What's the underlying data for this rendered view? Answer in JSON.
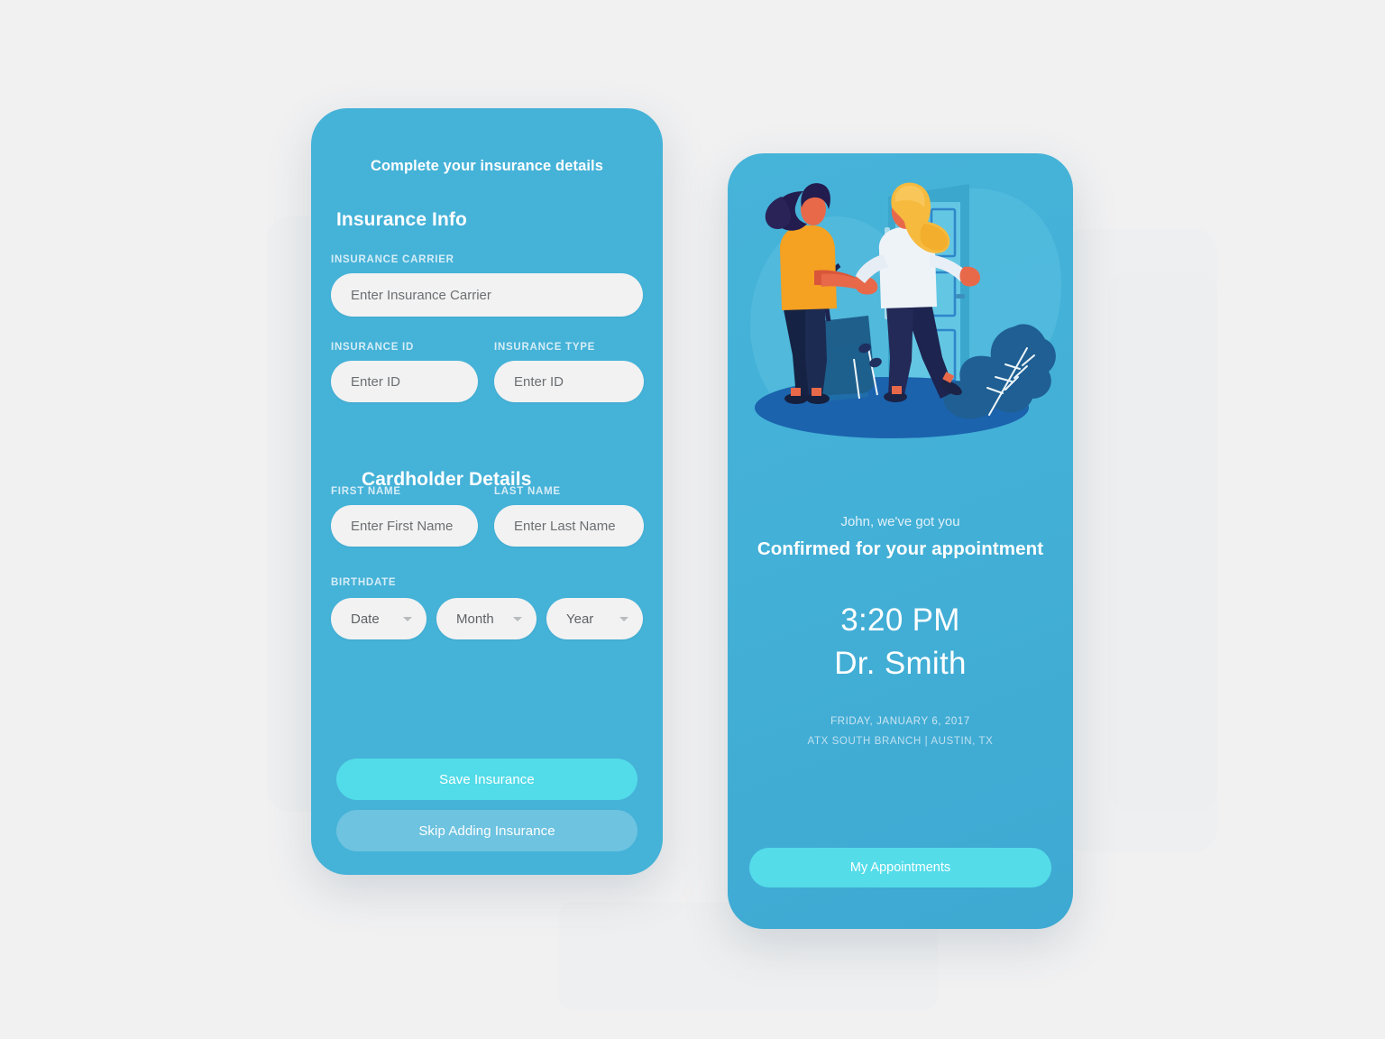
{
  "page": {
    "background_color": "#f1f1f2"
  },
  "insurance_screen": {
    "title": "Complete your insurance details",
    "sections": [
      {
        "heading": "Insurance Info"
      },
      {
        "heading": "Cardholder Details"
      }
    ],
    "fields": {
      "carrier": {
        "label": "INSURANCE CARRIER",
        "placeholder": "Enter Insurance Carrier",
        "value": ""
      },
      "insurance_id": {
        "label": "INSURANCE ID",
        "placeholder": "Enter ID",
        "value": ""
      },
      "insurance_type": {
        "label": "INSURANCE TYPE",
        "placeholder": "Enter ID",
        "value": ""
      },
      "first_name": {
        "label": "FIRST NAME",
        "placeholder": "Enter First Name",
        "value": ""
      },
      "last_name": {
        "label": "LAST NAME",
        "placeholder": "Enter Last Name",
        "value": ""
      },
      "birthdate": {
        "label": "BIRTHDATE",
        "day": {
          "selected": "Date"
        },
        "month": {
          "selected": "Month"
        },
        "year": {
          "selected": "Year"
        }
      }
    },
    "buttons": {
      "primary": "Save Insurance",
      "secondary": "Skip Adding Insurance"
    },
    "colors": {
      "card": "#45b2d8",
      "primary_button": "#52dbe8",
      "field": "#f2f2f2"
    }
  },
  "confirmation_screen": {
    "greeting": "John, we've got you",
    "headline": "Confirmed for your appointment",
    "time": "3:20 PM",
    "doctor": "Dr. Smith",
    "date": "FRIDAY, JANUARY 6, 2017",
    "location": "ATX SOUTH BRANCH  |  AUSTIN, TX",
    "button": "My Appointments",
    "illustration": {
      "name": "two-women-greeting-at-door",
      "colors": {
        "backdrop_blob": "#5fc0e0",
        "floor": "#1f68b0",
        "door": "#5cc4e2",
        "door_frame": "#3ba4c6",
        "door_panel_line": "#2f7fc4",
        "hair_left": "#2a2458",
        "top_left": "#f4a023",
        "pants": "#20264f",
        "skin": "#e8694a",
        "bag": "#1c5f8e",
        "hair_right": "#f5b942",
        "shirt_right": "#eef3f8",
        "plant": "#1f5f94"
      }
    },
    "colors": {
      "card_top": "#46b3d9",
      "card_bottom": "#3ea9d2",
      "primary_button": "#54dce9"
    }
  }
}
